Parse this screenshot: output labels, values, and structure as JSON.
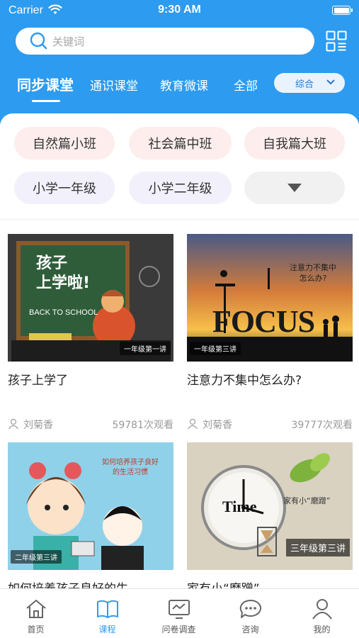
{
  "status_bar": {
    "carrier": "Carrier",
    "time": "9:30 AM"
  },
  "search": {
    "placeholder": "关键词"
  },
  "tabs": [
    {
      "label": "同步课堂",
      "active": true
    },
    {
      "label": "通识课堂",
      "active": false
    },
    {
      "label": "教育微课",
      "active": false
    },
    {
      "label": "全部",
      "active": false
    }
  ],
  "sort": {
    "selected": "综合"
  },
  "filters": {
    "row1": [
      "自然篇小班",
      "社会篇中班",
      "自我篇大班"
    ],
    "row2": [
      "小学一年级",
      "小学二年级"
    ],
    "expand_icon": "triangle-down-icon"
  },
  "courses": [
    {
      "title": "孩子上学了",
      "teacher": "刘菊香",
      "views": "59781次观看",
      "tag": "一年级第一讲",
      "chalk_title": "孩子\n上学啦!",
      "chalk_sub": "BACK TO SCHOOL"
    },
    {
      "title": "注意力不集中怎么办?",
      "teacher": "刘菊香",
      "views": "39777次观看",
      "tag": "一年级第三讲",
      "art_question": "注意力不集中\n怎么办?",
      "art_word": "FOCUS"
    },
    {
      "title": "如何培养孩子良好的生",
      "teacher": "",
      "views": "",
      "tag": "二年级第三讲",
      "art_caption": "如何培养孩子良好\n的生活习惯"
    },
    {
      "title": "家有小“磨蹭”",
      "teacher": "",
      "views": "",
      "tag": "三年级第三讲",
      "art_caption": "家有小“磨蹭”",
      "art_word": "Time"
    }
  ],
  "bottom_nav": [
    {
      "label": "首页",
      "icon": "home-icon",
      "active": false
    },
    {
      "label": "课程",
      "icon": "book-icon",
      "active": true
    },
    {
      "label": "问卷调查",
      "icon": "survey-monitor-icon",
      "active": false
    },
    {
      "label": "咨询",
      "icon": "chat-bubble-icon",
      "active": false
    },
    {
      "label": "我的",
      "icon": "user-icon",
      "active": false
    }
  ],
  "colors": {
    "brand_blue": "#2d9bef",
    "chip_pink": "#fdeeed",
    "chip_lavender": "#f2f1fb",
    "chip_gray": "#f1f1f1",
    "meta_gray": "#9a9a9a"
  }
}
